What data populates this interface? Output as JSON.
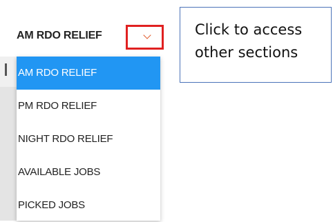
{
  "select": {
    "current_value": "AM RDO RELIEF",
    "toggle_icon": "chevron-down-icon"
  },
  "callout": {
    "line1": "Click to access",
    "line2": "other sections"
  },
  "dropdown": {
    "options": [
      {
        "label": "AM RDO RELIEF",
        "selected": true
      },
      {
        "label": "PM RDO RELIEF",
        "selected": false
      },
      {
        "label": "NIGHT RDO RELIEF",
        "selected": false
      },
      {
        "label": "AVAILABLE JOBS",
        "selected": false
      },
      {
        "label": "PICKED JOBS",
        "selected": false
      }
    ]
  },
  "colors": {
    "selected_bg": "#2196f3",
    "highlight_border": "#e02020",
    "callout_border": "#4a72b8"
  }
}
